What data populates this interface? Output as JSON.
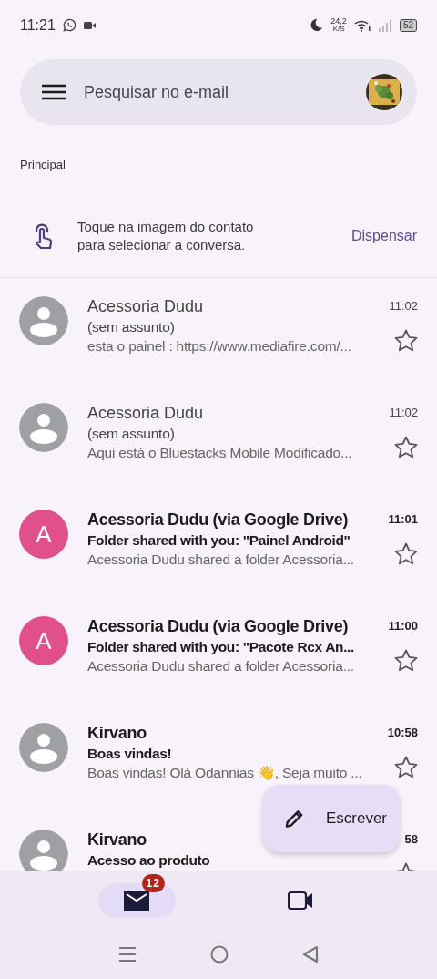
{
  "status_bar": {
    "time": "11:21",
    "speed": "24,2",
    "speed_unit": "K/S",
    "battery": "52"
  },
  "search": {
    "placeholder": "Pesquisar no e-mail"
  },
  "section_label": "Principal",
  "tip": {
    "text": "Toque na imagem do contato para selecionar a conversa.",
    "action": "Dispensar"
  },
  "emails": [
    {
      "sender": "Acessoria Dudu",
      "subject": "(sem assunto)",
      "snippet": "esta o painel : https://www.mediafire.com/...",
      "time": "11:02",
      "unread": false,
      "starred": false,
      "avatar": {
        "kind": "person",
        "color": "#9ea0a3"
      }
    },
    {
      "sender": "Acessoria Dudu",
      "subject": "(sem assunto)",
      "snippet": "Aqui está o Bluestacks Mobile Modificado...",
      "time": "11:02",
      "unread": false,
      "starred": false,
      "avatar": {
        "kind": "person",
        "color": "#9ea0a3"
      }
    },
    {
      "sender": "Acessoria Dudu (via Google Drive)",
      "subject": "Folder shared with you: \"Painel Android\"",
      "snippet": "Acessoria Dudu shared a folder Acessoria...",
      "time": "11:01",
      "unread": true,
      "starred": false,
      "avatar": {
        "kind": "letter",
        "letter": "A",
        "color": "#e0508c"
      }
    },
    {
      "sender": "Acessoria Dudu (via Google Drive)",
      "subject": "Folder shared with you: \"Pacote Rcx An...",
      "snippet": "Acessoria Dudu shared a folder Acessoria...",
      "time": "11:00",
      "unread": true,
      "starred": false,
      "avatar": {
        "kind": "letter",
        "letter": "A",
        "color": "#e0508c"
      }
    },
    {
      "sender": "Kirvano",
      "subject": "Boas vindas!",
      "snippet": "Boas vindas! Olá Odannias 👋, Seja muito ...",
      "time": "10:58",
      "unread": true,
      "starred": false,
      "avatar": {
        "kind": "person",
        "color": "#9ea0a3"
      }
    },
    {
      "sender": "Kirvano",
      "subject": "Acesso ao produto",
      "time": "58",
      "unread": true,
      "starred": false,
      "avatar": {
        "kind": "person",
        "color": "#9ea0a3"
      }
    }
  ],
  "compose": {
    "label": "Escrever"
  },
  "bottom_nav": [
    {
      "kind": "mail",
      "selected": true,
      "badge": "12"
    },
    {
      "kind": "video",
      "selected": false
    }
  ]
}
